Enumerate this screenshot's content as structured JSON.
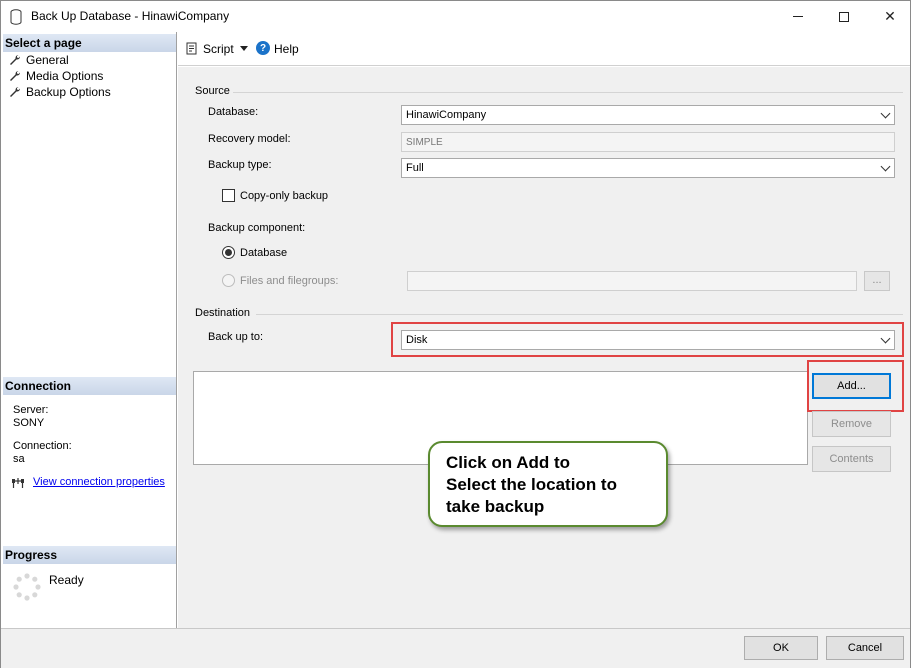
{
  "window": {
    "title": "Back Up Database - HinawiCompany",
    "minimize": "—",
    "maximize": "☐",
    "close": "✕"
  },
  "sidebar": {
    "select_page_header": "Select a page",
    "pages": [
      {
        "label": "General",
        "icon": "wrench-icon"
      },
      {
        "label": "Media Options",
        "icon": "wrench-icon"
      },
      {
        "label": "Backup Options",
        "icon": "wrench-icon"
      }
    ],
    "connection_header": "Connection",
    "server_label": "Server:",
    "server_value": "SONY",
    "connection_label": "Connection:",
    "connection_value": "sa",
    "view_connection_link": "View connection properties",
    "progress_header": "Progress",
    "progress_status": "Ready"
  },
  "toolbar": {
    "script_label": "Script",
    "help_label": "Help"
  },
  "source": {
    "group_title": "Source",
    "database_label": "Database:",
    "database_value": "HinawiCompany",
    "recovery_label": "Recovery model:",
    "recovery_value": "SIMPLE",
    "backup_type_label": "Backup type:",
    "backup_type_value": "Full",
    "copy_only_label": "Copy-only backup",
    "copy_only_checked": false,
    "component_label": "Backup component:",
    "component_database": "Database",
    "component_files": "Files and filegroups:",
    "ellipsis": "..."
  },
  "destination": {
    "group_title": "Destination",
    "backup_to_label": "Back up to:",
    "backup_to_value": "Disk",
    "add_button": "Add...",
    "remove_button": "Remove",
    "contents_button": "Contents"
  },
  "callout": {
    "line1": "Click on Add to",
    "line2": "Select the location to",
    "line3": "take backup"
  },
  "footer": {
    "ok_button": "OK",
    "cancel_button": "Cancel"
  },
  "colors": {
    "highlight_red": "#e04343",
    "callout_border": "#5a8a2f",
    "primary_button_border": "#0078d7",
    "link": "#0000ee"
  }
}
